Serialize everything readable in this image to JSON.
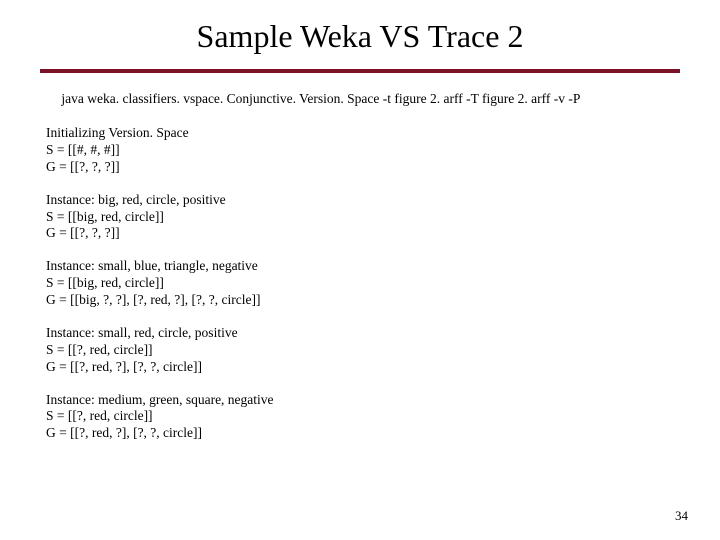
{
  "title": "Sample Weka VS Trace 2",
  "command": " java weka. classifiers. vspace. Conjunctive. Version. Space -t figure 2. arff -T figure 2. arff -v -P",
  "blocks": [
    "Initializing Version. Space\nS = [[#, #, #]]\nG = [[?, ?, ?]]",
    "Instance: big, red, circle, positive\nS = [[big, red, circle]]\nG = [[?, ?, ?]]",
    "Instance: small, blue, triangle, negative\nS = [[big, red, circle]]\nG = [[big, ?, ?], [?, red, ?], [?, ?, circle]]",
    "Instance: small, red, circle, positive\nS = [[?, red, circle]]\nG = [[?, red, ?], [?, ?, circle]]",
    "Instance: medium, green, square, negative\nS = [[?, red, circle]]\nG = [[?, red, ?], [?, ?, circle]]"
  ],
  "page_number": "34",
  "colors": {
    "accent": "#7a1228"
  }
}
